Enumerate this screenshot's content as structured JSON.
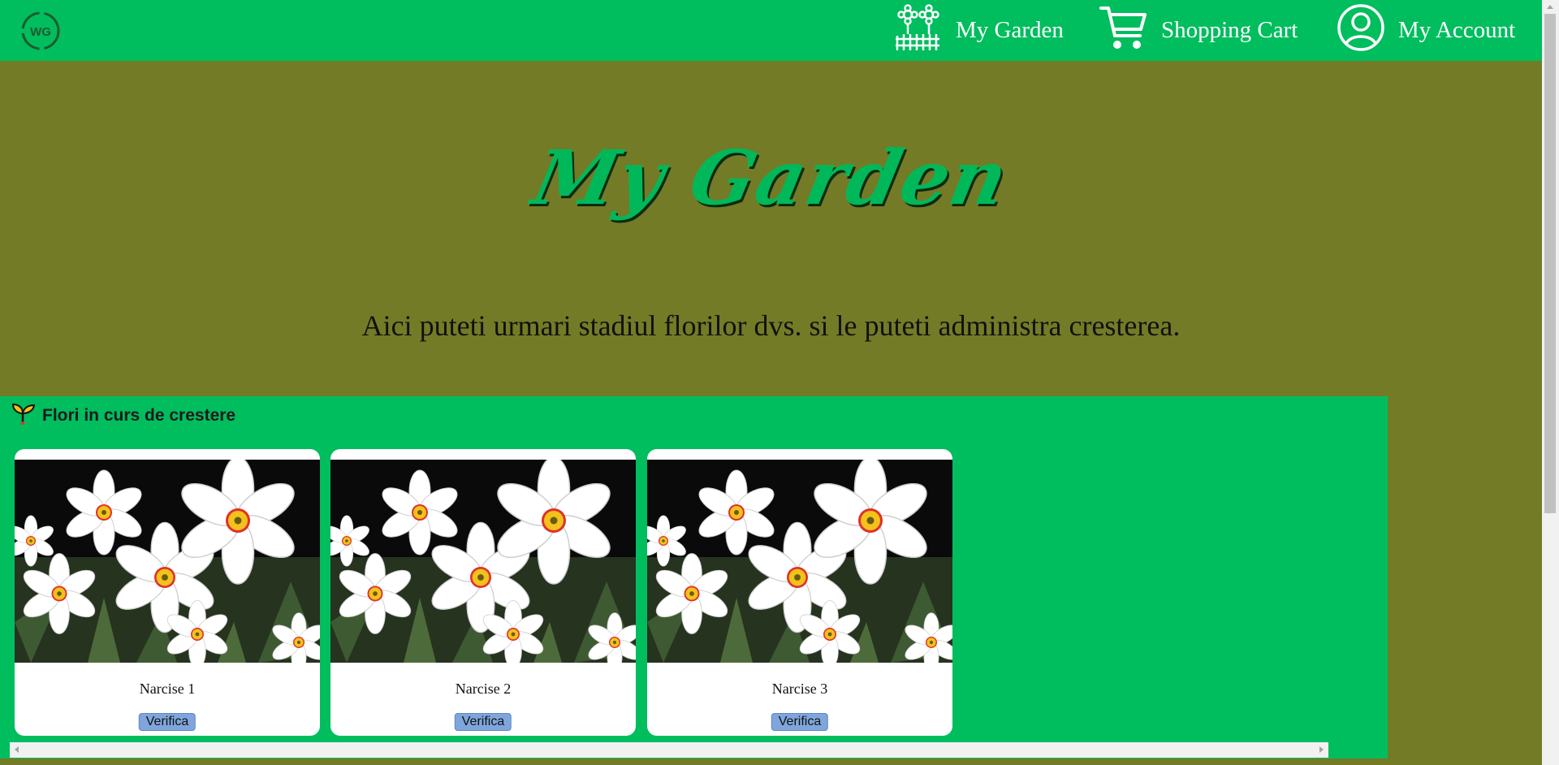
{
  "header": {
    "logo_text": "WG",
    "logo_icon": "wg-logo-icon",
    "nav": [
      {
        "label": "My Garden",
        "icon": "flowers-fence-icon"
      },
      {
        "label": "Shopping Cart",
        "icon": "shopping-cart-icon"
      },
      {
        "label": "My Account",
        "icon": "user-account-icon"
      }
    ]
  },
  "hero": {
    "title": "My Garden",
    "subtitle": "Aici puteti urmari stadiul florilor dvs. si le puteti administra cresterea."
  },
  "growing_section": {
    "heading": "Flori in curs de crestere",
    "heading_icon": "sprout-icon",
    "cards": [
      {
        "name": "Narcise 1",
        "button": "Verifica"
      },
      {
        "name": "Narcise 2",
        "button": "Verifica"
      },
      {
        "name": "Narcise 3",
        "button": "Verifica"
      }
    ]
  },
  "colors": {
    "header_bg": "#00bd5e",
    "page_bg": "#737b26",
    "title_green": "#00b85a",
    "button_bg": "#7fa6dc"
  }
}
